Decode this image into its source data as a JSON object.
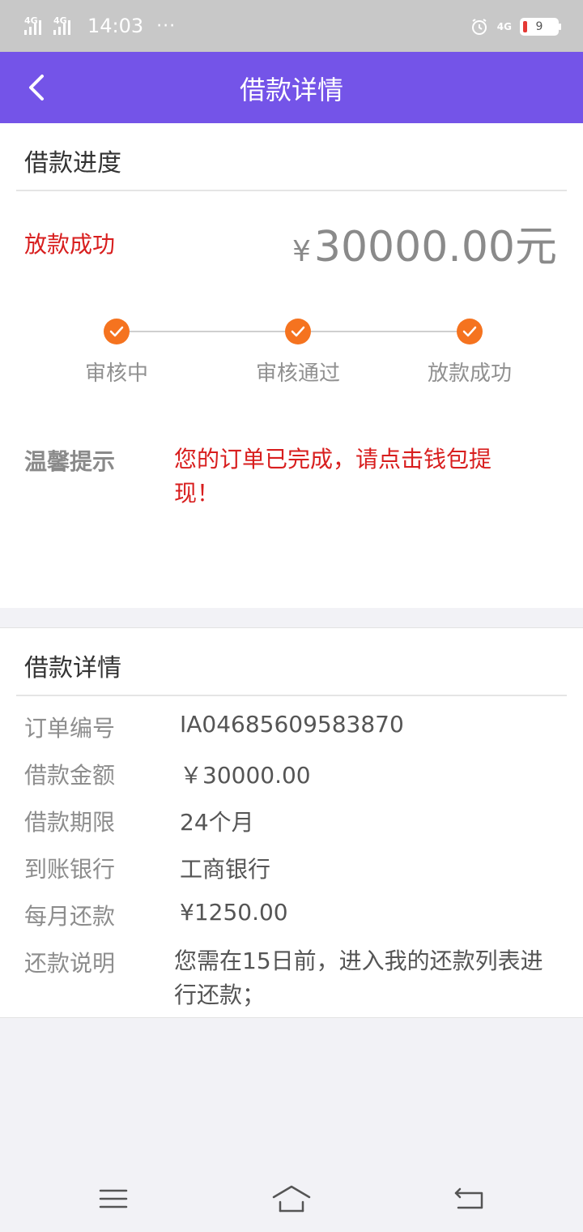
{
  "status_bar": {
    "signal_1": "4G",
    "signal_2": "4G",
    "time": "14:03",
    "more": "···",
    "alarm_icon": "alarm-clock-icon",
    "network": "4G",
    "battery_level": "9"
  },
  "header": {
    "title": "借款详情",
    "back_icon": "chevron-left-icon"
  },
  "progress_card": {
    "title": "借款进度",
    "status": "放款成功",
    "currency_symbol": "¥",
    "amount": "30000.00元",
    "steps": [
      {
        "label": "审核中",
        "done": true
      },
      {
        "label": "审核通过",
        "done": true
      },
      {
        "label": "放款成功",
        "done": true
      }
    ],
    "tip_label": "温馨提示",
    "tip_text": "您的订单已完成，请点击钱包提现！"
  },
  "detail_card": {
    "title": "借款详情",
    "rows": [
      {
        "label": "订单编号",
        "value": "IA04685609583870"
      },
      {
        "label": "借款金额",
        "value": "￥30000.00"
      },
      {
        "label": "借款期限",
        "value": "24个月"
      },
      {
        "label": "到账银行",
        "value": "工商银行"
      },
      {
        "label": "每月还款",
        "value": "¥1250.00"
      },
      {
        "label": "还款说明",
        "value": "您需在15日前，进入我的还款列表进行还款；"
      }
    ]
  },
  "bottom_nav": {
    "menu_icon": "menu-icon",
    "home_icon": "home-icon",
    "back_icon": "return-icon"
  },
  "colors": {
    "header_bg": "#7454e8",
    "accent_red": "#d81e1e",
    "step_orange": "#f5731f"
  }
}
